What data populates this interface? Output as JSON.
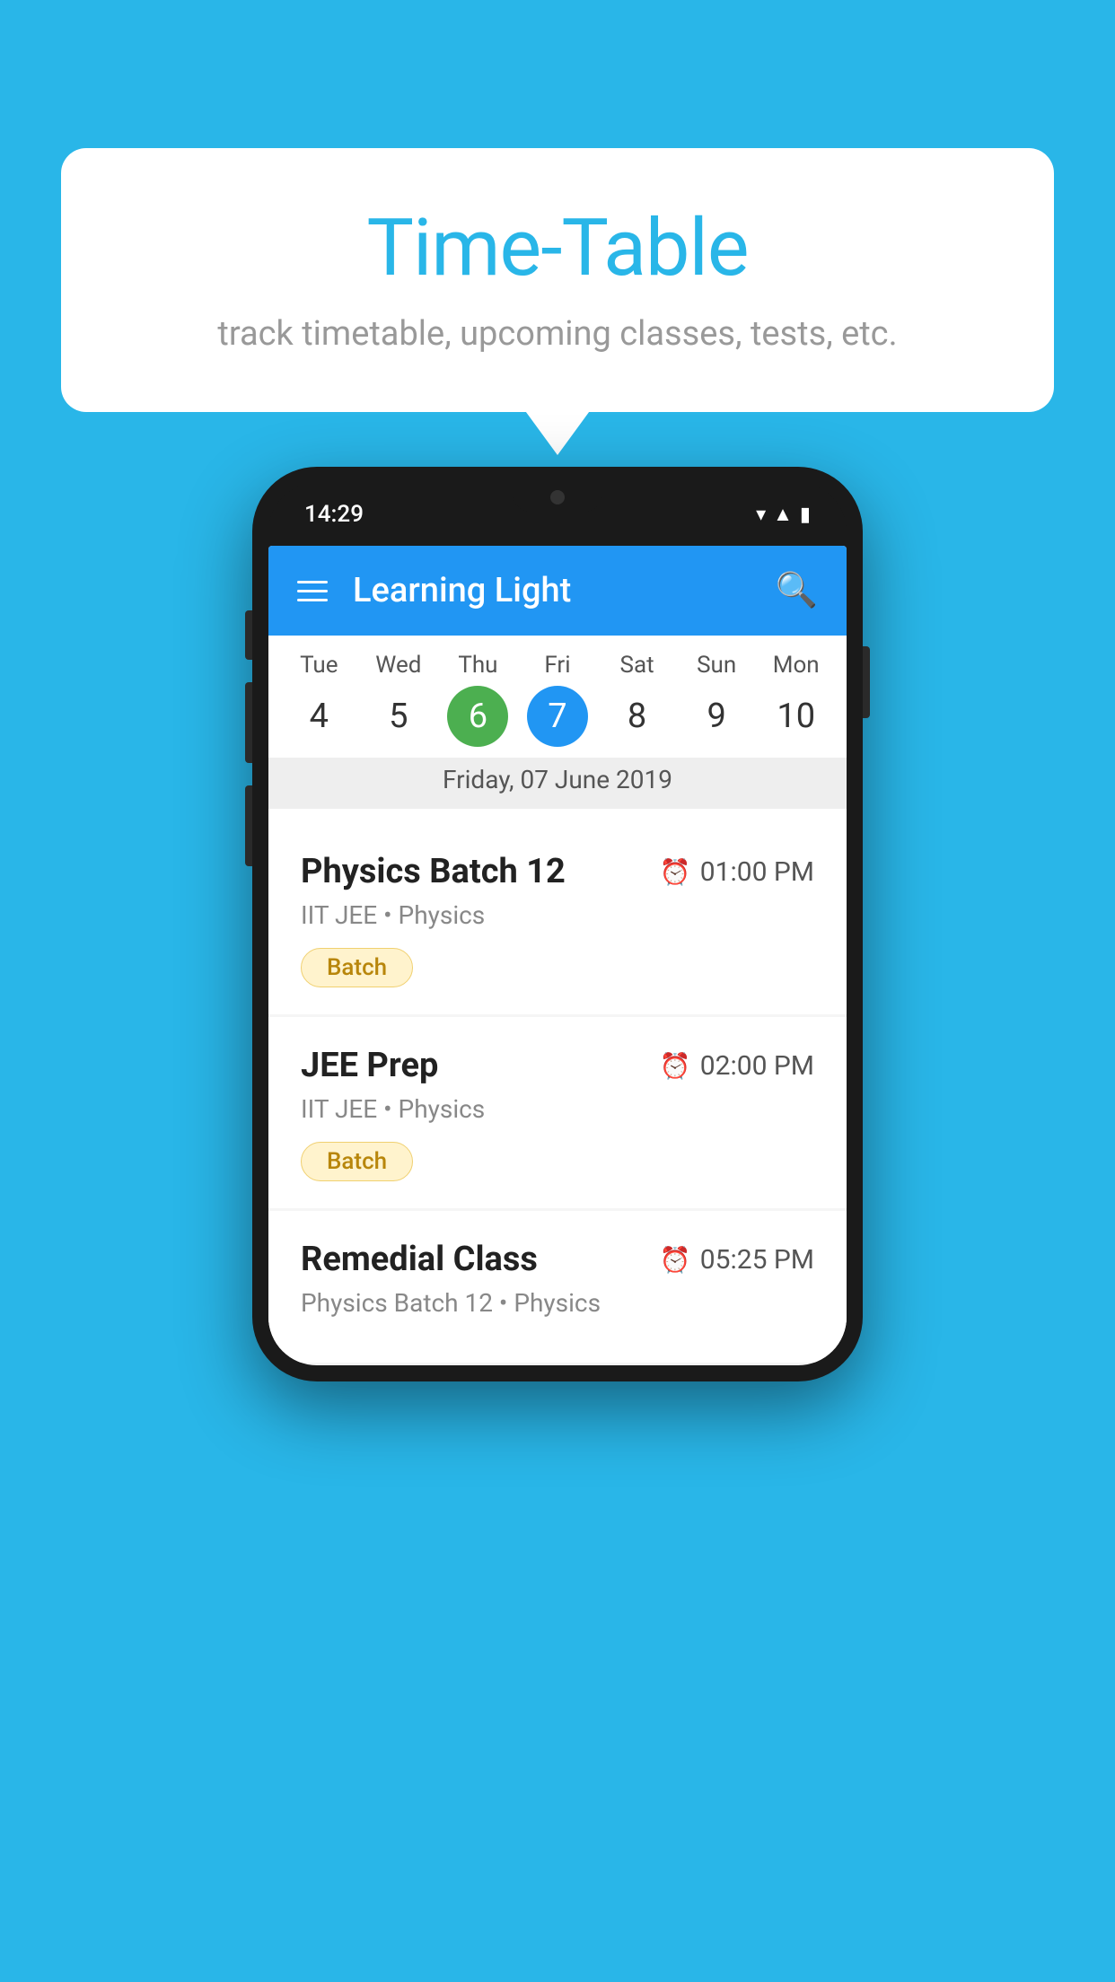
{
  "background_color": "#29B6E8",
  "bubble": {
    "title": "Time-Table",
    "subtitle": "track timetable, upcoming classes, tests, etc."
  },
  "phone": {
    "status_time": "14:29",
    "app_title": "Learning Light",
    "calendar": {
      "days": [
        "Tue",
        "Wed",
        "Thu",
        "Fri",
        "Sat",
        "Sun",
        "Mon"
      ],
      "dates": [
        "4",
        "5",
        "6",
        "7",
        "8",
        "9",
        "10"
      ],
      "today_index": 2,
      "selected_index": 3,
      "selected_date_label": "Friday, 07 June 2019"
    },
    "classes": [
      {
        "name": "Physics Batch 12",
        "time": "01:00 PM",
        "meta": "IIT JEE • Physics",
        "tag": "Batch"
      },
      {
        "name": "JEE Prep",
        "time": "02:00 PM",
        "meta": "IIT JEE • Physics",
        "tag": "Batch"
      },
      {
        "name": "Remedial Class",
        "time": "05:25 PM",
        "meta": "Physics Batch 12 • Physics",
        "tag": null
      }
    ]
  }
}
